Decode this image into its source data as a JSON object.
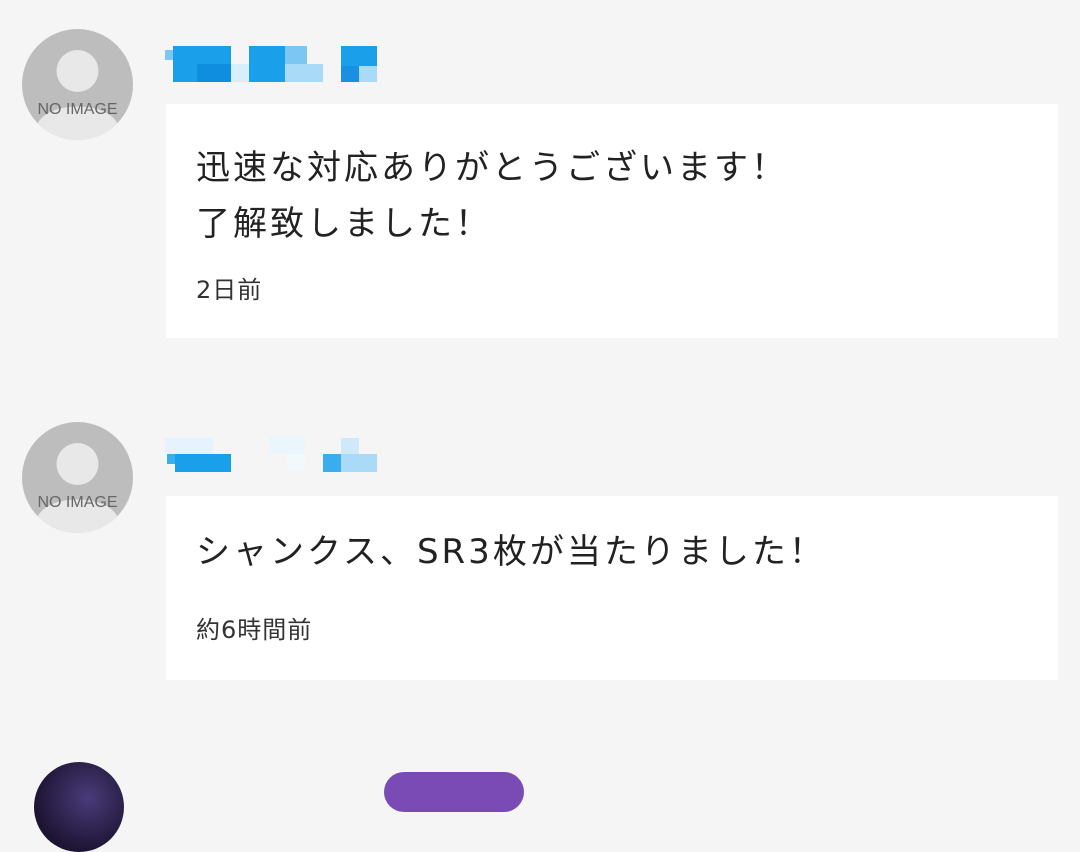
{
  "comments": [
    {
      "avatar_label": "NO IMAGE",
      "avatar_icon": "user-placeholder-icon",
      "text": "迅速な対応ありがとうございます！\n了解致しました！",
      "time": "2日前"
    },
    {
      "avatar_label": "NO IMAGE",
      "avatar_icon": "user-placeholder-icon",
      "text": "シャンクス、SR3枚が当たりました！",
      "time": "約6時間前"
    }
  ],
  "colors": {
    "background": "#f5f5f5",
    "bubble": "#ffffff",
    "username_blur": "#1a9be8",
    "avatar": "#bdbdbd",
    "badge": "#7a4bb5"
  }
}
